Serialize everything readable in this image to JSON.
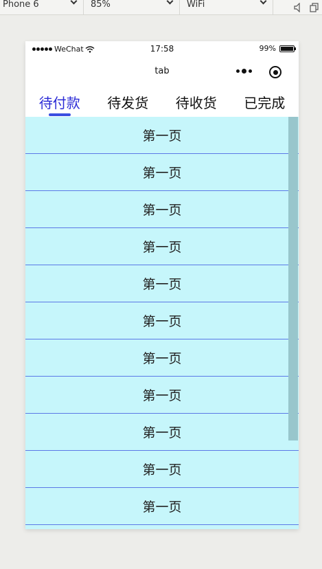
{
  "toolbar": {
    "device": "Phone 6",
    "zoom": "85%",
    "network": "WiFi",
    "icons": [
      "speaker-icon",
      "copy-icon"
    ]
  },
  "statusbar": {
    "carrier": "WeChat",
    "time": "17:58",
    "battery": "99%"
  },
  "navbar": {
    "title": "tab"
  },
  "tabs": [
    {
      "label": "待付款",
      "active": true
    },
    {
      "label": "待发货",
      "active": false
    },
    {
      "label": "待收货",
      "active": false
    },
    {
      "label": "已完成",
      "active": false
    }
  ],
  "list": {
    "items": [
      "第一页",
      "第一页",
      "第一页",
      "第一页",
      "第一页",
      "第一页",
      "第一页",
      "第一页",
      "第一页",
      "第一页",
      "第一页"
    ]
  },
  "colors": {
    "active_tab": "#2b2bd6",
    "underline": "#3a4fe0",
    "list_bg": "#c6f6fb",
    "divider": "#5a78e6"
  }
}
